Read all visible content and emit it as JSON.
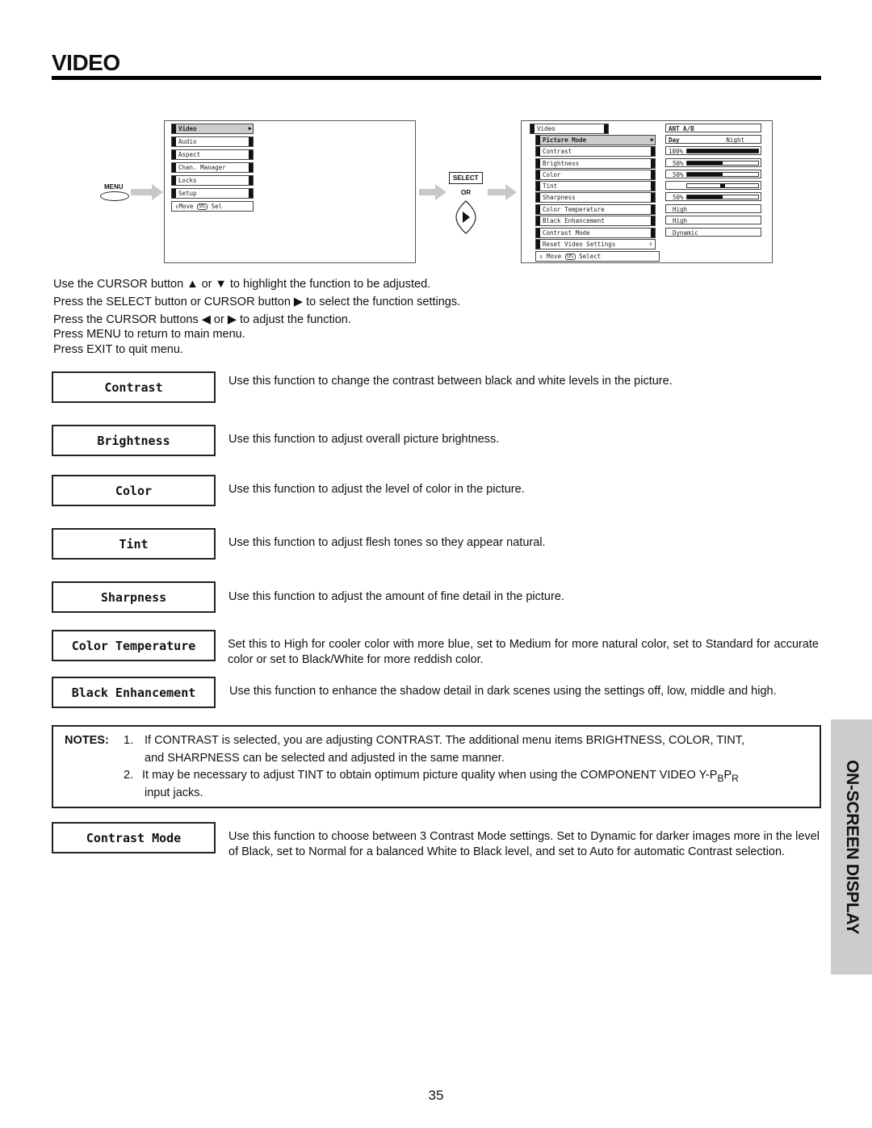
{
  "page": {
    "title": "VIDEO",
    "page_number": "35",
    "side_tab": "ON-SCREEN DISPLAY"
  },
  "diagram": {
    "menu_button_label": "MENU",
    "select_button_label": "SELECT",
    "or_label": "OR",
    "cursor_right_icon": "triangle-right",
    "main_menu": {
      "items": [
        {
          "label": "Video",
          "selected": true
        },
        {
          "label": "Audio",
          "selected": false
        },
        {
          "label": "Aspect",
          "selected": false
        },
        {
          "label": "Chan. Manager",
          "selected": false
        },
        {
          "label": "Locks",
          "selected": false
        },
        {
          "label": "Setup",
          "selected": false
        }
      ],
      "help": {
        "move": "Move",
        "sel_badge": "SEL",
        "action": "Sel"
      }
    },
    "video_menu": {
      "header": "Video",
      "items": [
        {
          "label": "Picture Mode",
          "selected": true
        },
        {
          "label": "Contrast",
          "selected": false
        },
        {
          "label": "Brightness",
          "selected": false
        },
        {
          "label": "Color",
          "selected": false
        },
        {
          "label": "Tint",
          "selected": false
        },
        {
          "label": "Sharpness",
          "selected": false
        },
        {
          "label": "Color Temperature",
          "selected": false
        },
        {
          "label": "Black Enhancement",
          "selected": false
        },
        {
          "label": "Contrast Mode",
          "selected": false
        },
        {
          "label": "Reset Video Settings",
          "selected": false
        }
      ],
      "help": {
        "move": "Move",
        "sel_badge": "SEL",
        "action": "Select"
      },
      "values": {
        "input": "ANT A/B",
        "picture_mode_left": "Day",
        "picture_mode_right": "Night",
        "contrast": {
          "label": "100%",
          "fraction": 1.0
        },
        "brightness": {
          "label": "50%",
          "fraction": 0.5
        },
        "color": {
          "label": "50%",
          "fraction": 0.5
        },
        "tint": {
          "fraction": 0.5
        },
        "sharpness": {
          "label": "50%",
          "fraction": 0.5
        },
        "color_temperature": "High",
        "black_enhancement": "High",
        "contrast_mode": "Dynamic"
      }
    }
  },
  "instructions": [
    "Use the CURSOR button ▲ or ▼ to highlight the function to be adjusted.",
    "Press the SELECT button or CURSOR button ▶ to select the function settings.",
    "Press the CURSOR buttons ◀ or ▶ to adjust the function.",
    "Press MENU to return to main menu.",
    "Press EXIT to quit menu."
  ],
  "functions": [
    {
      "name": "Contrast",
      "description": "Use this function to change the contrast between black and white levels in the picture."
    },
    {
      "name": "Brightness",
      "description": "Use this function to adjust overall picture brightness."
    },
    {
      "name": "Color",
      "description": "Use this function to adjust the level of color in the picture."
    },
    {
      "name": "Tint",
      "description": "Use this function to adjust flesh tones so they appear natural."
    },
    {
      "name": "Sharpness",
      "description": "Use this function to adjust the amount of fine detail in the picture."
    },
    {
      "name": "Color Temperature",
      "description": "Set this to High for cooler color with more blue, set to Medium for more natural color, set to Standard for accurate color or set to Black/White for more reddish color."
    },
    {
      "name": "Black Enhancement",
      "description": "Use this function to enhance the shadow detail in dark scenes using the settings off, low, middle and high."
    },
    {
      "name": "Contrast Mode",
      "description": "Use this function to choose between 3 Contrast Mode settings.  Set to Dynamic for darker images more in the level of Black, set to Normal for a balanced White to Black level, and set to Auto for automatic Contrast selection."
    }
  ],
  "notes": {
    "label": "NOTES:",
    "items": [
      {
        "num": "1.",
        "line1": "If CONTRAST is selected, you are adjusting CONTRAST.  The additional menu items BRIGHTNESS, COLOR, TINT,",
        "line2": "and SHARPNESS can be selected and adjusted in the same manner."
      },
      {
        "num": "2.",
        "line1_pre": "It may be necessary to adjust TINT to obtain optimum picture quality when using the COMPONENT VIDEO Y-P",
        "sub_b": "B",
        "p": "P",
        "sub_r": "R",
        "line2": "input jacks."
      }
    ]
  }
}
